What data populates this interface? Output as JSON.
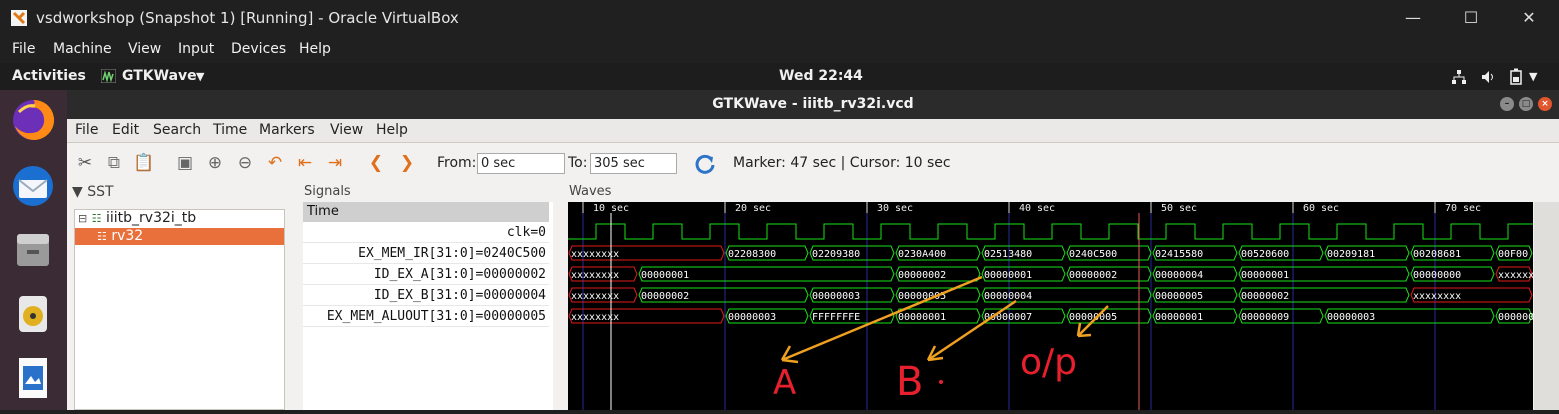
{
  "vbox": {
    "title": "vsdworkshop (Snapshot 1) [Running] - Oracle VirtualBox",
    "menu": [
      "File",
      "Machine",
      "View",
      "Input",
      "Devices",
      "Help"
    ]
  },
  "ubuntu": {
    "activities": "Activities",
    "app_name": "GTKWave",
    "clock": "Wed 22:44"
  },
  "gtkwave": {
    "title": "GTKWave - iiitb_rv32i.vcd",
    "menu": [
      "File",
      "Edit",
      "Search",
      "Time",
      "Markers",
      "View",
      "Help"
    ],
    "from_label": "From:",
    "from_value": "0 sec",
    "to_label": "To:",
    "to_value": "305 sec",
    "marker_cursor": "Marker: 47 sec  |  Cursor: 10 sec",
    "sst_label": "SST",
    "sst_tree": [
      "iiitb_rv32i_tb",
      "rv32"
    ],
    "signals_label": "Signals",
    "time_label": "Time",
    "signals": [
      "clk=0",
      "EX_MEM_IR[31:0]=0240C500",
      "ID_EX_A[31:0]=00000002",
      "ID_EX_B[31:0]=00000004",
      "EX_MEM_ALUOUT[31:0]=00000005"
    ],
    "waves_label": "Waves"
  },
  "chart_data": {
    "type": "timing",
    "time_ticks": [
      "10 sec",
      "20 sec",
      "30 sec",
      "40 sec",
      "50 sec",
      "60 sec",
      "70 sec"
    ],
    "buses": [
      {
        "name": "EX_MEM_IR[31:0]",
        "values": [
          "xxxxxxxx",
          "02208300",
          "02209380",
          "0230A400",
          "02513480",
          "0240C500",
          "02415580",
          "00520600",
          "00209181",
          "00208681",
          "00F00"
        ]
      },
      {
        "name": "ID_EX_A[31:0]",
        "values": [
          "xxxxxxxx",
          "00000001",
          "00000002",
          "00000001",
          "00000002",
          "00000004",
          "00000001",
          "00000000",
          "xxxxxx"
        ]
      },
      {
        "name": "ID_EX_B[31:0]",
        "values": [
          "xxxxxxxx",
          "00000002",
          "00000003",
          "00000005",
          "00000004",
          "00000005",
          "00000002",
          "xxxxxxxx"
        ]
      },
      {
        "name": "EX_MEM_ALUOUT[31:0]",
        "values": [
          "xxxxxxxx",
          "00000003",
          "FFFFFFFE",
          "00000001",
          "00000007",
          "00000005",
          "00000001",
          "00000009",
          "00000003",
          "000000"
        ]
      }
    ],
    "annotations": [
      "A",
      "B",
      "o/p"
    ],
    "colors": {
      "background": "#000000",
      "bus": "#19e019",
      "unknown": "#e01b1b",
      "clock": "#19e019",
      "cursor": "#e85a5a",
      "annotation": "#e8202e",
      "arrow": "#f0a020"
    }
  }
}
